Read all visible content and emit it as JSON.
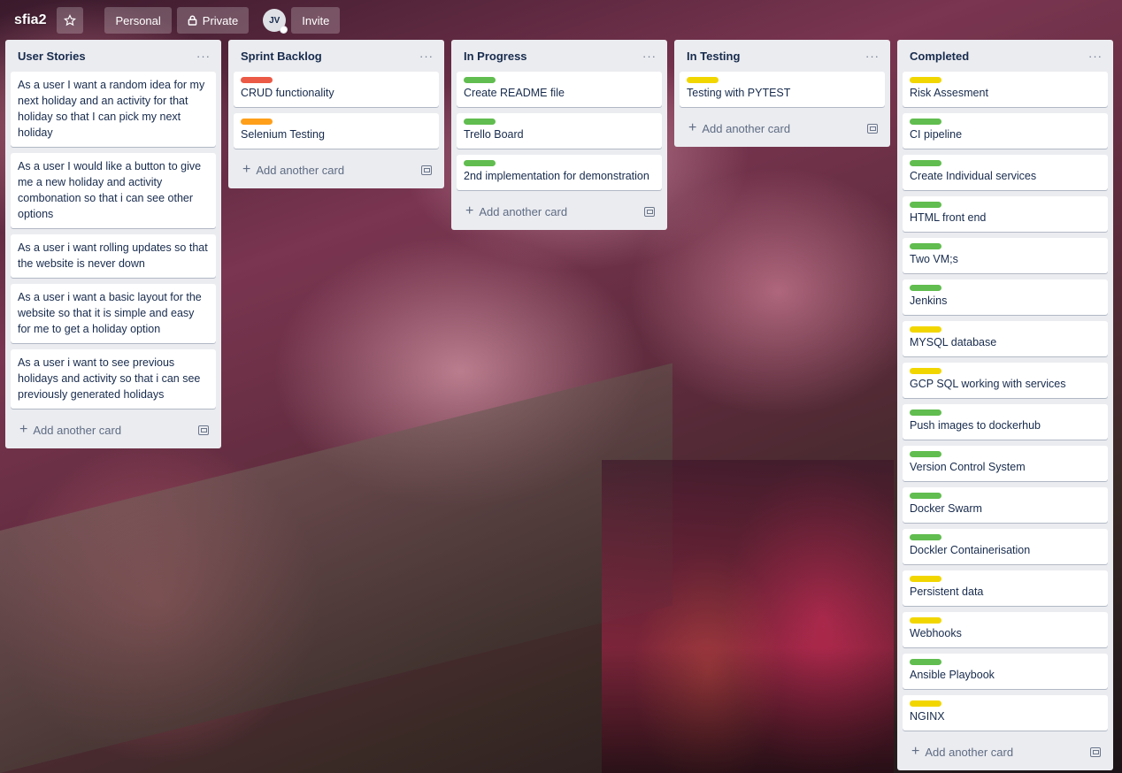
{
  "board": {
    "title": "sfia2",
    "workspace_label": "Personal",
    "visibility_label": "Private",
    "avatar_initials": "JV",
    "invite_label": "Invite"
  },
  "colors": {
    "green": "#61bd4f",
    "red": "#eb5a46",
    "orange": "#ff9f1a",
    "yellow": "#f2d600"
  },
  "icons": {
    "star": "star-icon",
    "lock": "lock-icon",
    "plus": "plus-icon",
    "template": "card-template-icon",
    "menu": "ellipsis-icon"
  },
  "add_card_label": "Add another card",
  "lists": [
    {
      "title": "User Stories",
      "cards": [
        {
          "text": "As a user I want a random idea for my next holiday and an activity for that holiday so that I can pick my next holiday",
          "label": null
        },
        {
          "text": "As a user I would like a button to give me a new holiday and activity combonation so that i can see other options",
          "label": null
        },
        {
          "text": "As a user i want rolling updates so that the website is never down",
          "label": null
        },
        {
          "text": "As a user i want a basic layout for the website so that it is simple and easy for me to get a holiday option",
          "label": null
        },
        {
          "text": "As a user i want to see previous holidays and activity so that i can see previously generated holidays",
          "label": null
        }
      ]
    },
    {
      "title": "Sprint Backlog",
      "cards": [
        {
          "text": "CRUD functionality",
          "label": "red"
        },
        {
          "text": "Selenium Testing",
          "label": "orange"
        }
      ]
    },
    {
      "title": "In Progress",
      "cards": [
        {
          "text": "Create README file",
          "label": "green"
        },
        {
          "text": "Trello Board",
          "label": "green"
        },
        {
          "text": "2nd implementation for demonstration",
          "label": "green"
        }
      ]
    },
    {
      "title": "In Testing",
      "cards": [
        {
          "text": "Testing with PYTEST",
          "label": "yellow"
        }
      ]
    },
    {
      "title": "Completed",
      "cards": [
        {
          "text": "Risk Assesment",
          "label": "yellow"
        },
        {
          "text": "CI pipeline",
          "label": "green"
        },
        {
          "text": "Create Individual services",
          "label": "green"
        },
        {
          "text": "HTML front end",
          "label": "green"
        },
        {
          "text": "Two VM;s",
          "label": "green"
        },
        {
          "text": "Jenkins",
          "label": "green"
        },
        {
          "text": "MYSQL database",
          "label": "yellow"
        },
        {
          "text": "GCP SQL working with services",
          "label": "yellow"
        },
        {
          "text": "Push images to dockerhub",
          "label": "green"
        },
        {
          "text": "Version Control System",
          "label": "green"
        },
        {
          "text": "Docker Swarm",
          "label": "green"
        },
        {
          "text": "Dockler Containerisation",
          "label": "green"
        },
        {
          "text": "Persistent data",
          "label": "yellow"
        },
        {
          "text": "Webhooks",
          "label": "yellow"
        },
        {
          "text": "Ansible Playbook",
          "label": "green"
        },
        {
          "text": "NGINX",
          "label": "yellow"
        }
      ]
    }
  ]
}
